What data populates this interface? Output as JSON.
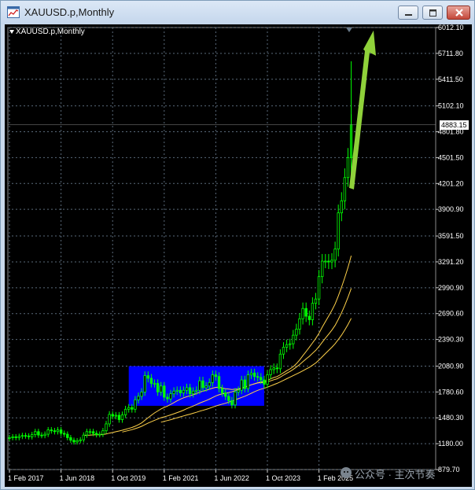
{
  "window": {
    "title": "XAUUSD.p,Monthly",
    "symbol_label": "XAUUSD.p,Monthly",
    "current_price": "4883.15"
  },
  "chart_data": {
    "type": "candlestick",
    "symbol": "XAUUSD.p",
    "timeframe": "Monthly",
    "y_ticks": [
      6012.1,
      5711.8,
      5411.5,
      5102.1,
      4801.8,
      4501.5,
      4201.2,
      3900.9,
      3591.5,
      3291.2,
      2990.9,
      2690.6,
      2390.3,
      2080.9,
      1780.6,
      1480.3,
      1180.0,
      879.7
    ],
    "y_tick_labels": [
      "6012.10",
      "5711.80",
      "5411.50",
      "5102.10",
      "4801.80",
      "4501.50",
      "4201.20",
      "3900.90",
      "3591.50",
      "3291.20",
      "2990.90",
      "2690.60",
      "2390.30",
      "2080.90",
      "1780.60",
      "1480.30",
      "1180.00",
      "879.70"
    ],
    "x_tick_labels": [
      "1 Feb 2017",
      "1 Jun 2018",
      "1 Oct 2019",
      "1 Feb 2021",
      "1 Jun 2022",
      "1 Oct 2023",
      "1 Feb 2025"
    ],
    "x_tick_index": [
      0,
      16,
      32,
      48,
      64,
      80,
      96
    ],
    "ylim": [
      879.7,
      6012.1
    ],
    "grid": true,
    "candle_color": "#00ff00",
    "background": "#000000",
    "ma_color": "#ffd24a",
    "highlight_box": {
      "color": "#0000ff",
      "start_index": 37,
      "end_index": 79,
      "low": 1620,
      "high": 2080
    },
    "arrow_color": "#8fd13a",
    "closes": [
      1250,
      1260,
      1250,
      1265,
      1275,
      1270,
      1260,
      1285,
      1320,
      1280,
      1275,
      1290,
      1340,
      1330,
      1320,
      1340,
      1300,
      1290,
      1250,
      1220,
      1200,
      1215,
      1225,
      1280,
      1320,
      1320,
      1300,
      1285,
      1290,
      1330,
      1410,
      1520,
      1500,
      1510,
      1460,
      1515,
      1580,
      1600,
      1580,
      1690,
      1730,
      1780,
      1970,
      1940,
      1880,
      1880,
      1780,
      1850,
      1720,
      1700,
      1760,
      1790,
      1800,
      1770,
      1800,
      1830,
      1760,
      1790,
      1800,
      1910,
      1830,
      1850,
      1890,
      1980,
      1960,
      1820,
      1770,
      1730,
      1680,
      1630,
      1780,
      1800,
      1920,
      1820,
      1980,
      2000,
      1960,
      1950,
      1920,
      1870,
      1980,
      2040,
      2060,
      2050,
      2220,
      2300,
      2330,
      2340,
      2440,
      2510,
      2630,
      2750,
      2660,
      2620,
      2810,
      2860,
      3120,
      3300,
      3300,
      3290,
      3310,
      3440,
      3860,
      4000,
      4270,
      4500,
      4883
    ],
    "ma_series": [
      {
        "period": 24,
        "start": 24,
        "end_price": 3370
      },
      {
        "period": 36,
        "start": 36,
        "end_price": 2990
      },
      {
        "period": 48,
        "start": 48,
        "end_price": 2640
      }
    ]
  },
  "watermark": {
    "text": "公众号 · 主次节奏"
  },
  "icons": {
    "app": "chart-app-icon",
    "minimize": "minimize-icon",
    "maximize": "maximize-icon",
    "close": "close-icon",
    "watermark": "wechat-icon"
  }
}
